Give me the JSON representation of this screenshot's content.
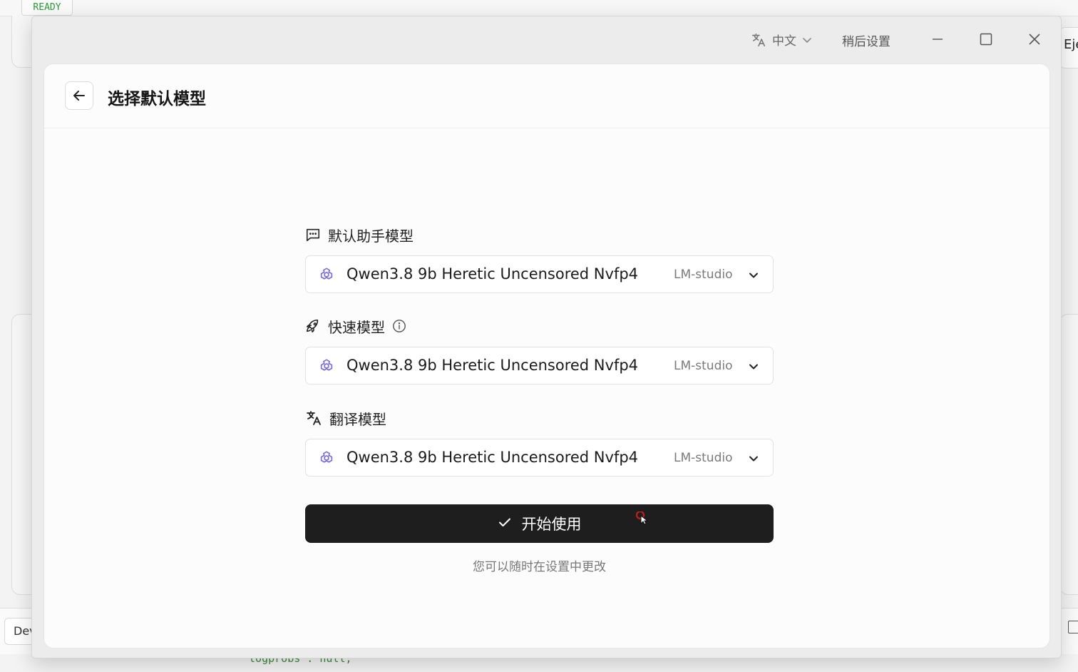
{
  "background": {
    "status_badge": "READY",
    "right_edge_text": "Eje",
    "bottom_tab": "Dev",
    "code_line": "\"logprobs\": null,"
  },
  "window": {
    "language": "中文",
    "later_settings": "稍后设置",
    "controls": [
      "minimize-icon",
      "maximize-icon",
      "close-icon"
    ]
  },
  "page": {
    "title": "选择默认模型"
  },
  "sections": [
    {
      "label": "默认助手模型",
      "icon": "chat-icon",
      "model": "Qwen3.8 9b Heretic Uncensored Nvfp4",
      "provider": "LM-studio"
    },
    {
      "label": "快速模型",
      "icon": "rocket-icon",
      "info_icon": "info-icon",
      "model": "Qwen3.8 9b Heretic Uncensored Nvfp4",
      "provider": "LM-studio"
    },
    {
      "label": "翻译模型",
      "icon": "translate-icon",
      "model": "Qwen3.8 9b Heretic Uncensored Nvfp4",
      "provider": "LM-studio"
    }
  ],
  "start_button": "开始使用",
  "hint": "您可以随时在设置中更改",
  "colors": {
    "primary_button": "#1e1e1e",
    "model_icon": "#7b6cd9",
    "ready_text": "#2f9a3a"
  }
}
